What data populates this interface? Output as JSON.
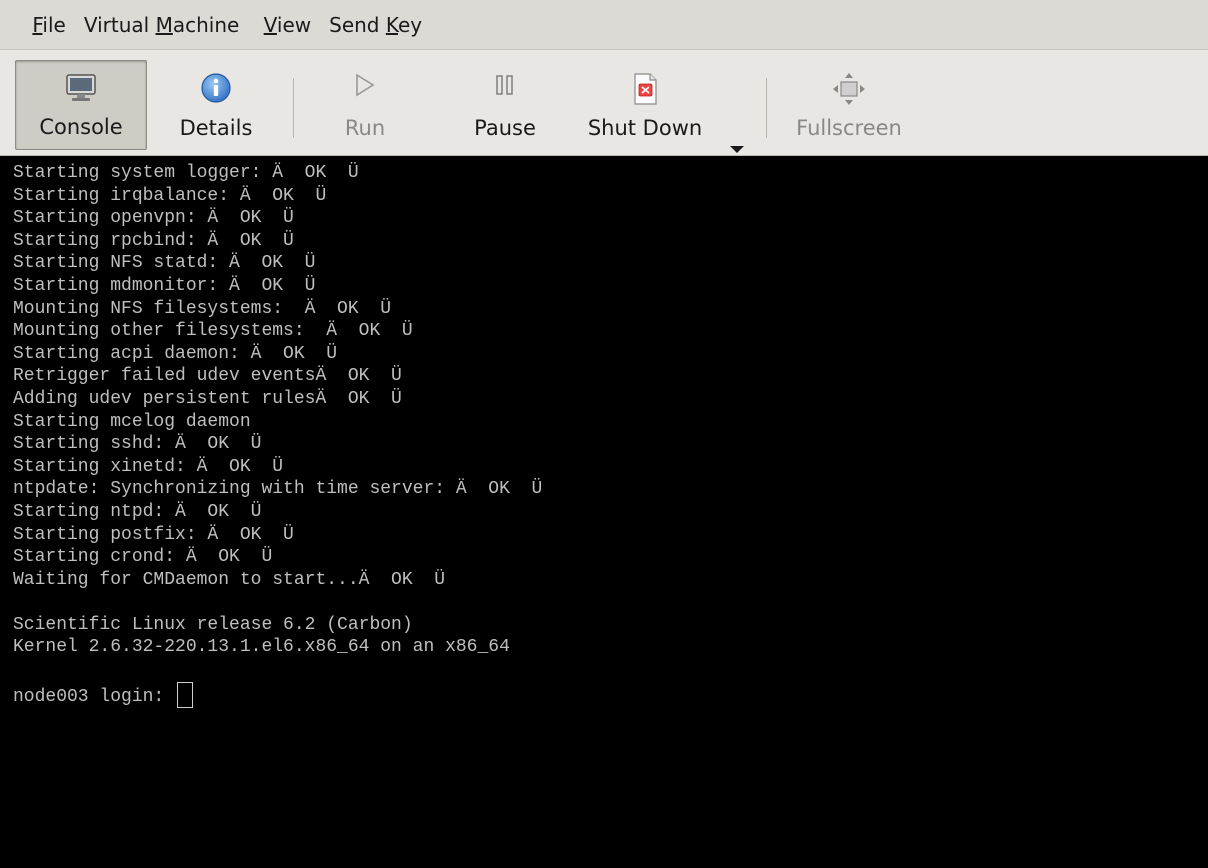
{
  "menubar": {
    "items": [
      {
        "pre": "",
        "key": "F",
        "post": "ile"
      },
      {
        "pre": "Virtual ",
        "key": "M",
        "post": "achine"
      },
      {
        "pre": "",
        "key": "V",
        "post": "iew"
      },
      {
        "pre": "Send ",
        "key": "K",
        "post": "ey"
      }
    ]
  },
  "toolbar": {
    "console_label": "Console",
    "details_label": "Details",
    "run_label": "Run",
    "pause_label": "Pause",
    "shutdown_label": "Shut Down",
    "fullscreen_label": "Fullscreen"
  },
  "console": {
    "lines": [
      "Starting system logger: Ä  OK  Ü",
      "Starting irqbalance: Ä  OK  Ü",
      "Starting openvpn: Ä  OK  Ü",
      "Starting rpcbind: Ä  OK  Ü",
      "Starting NFS statd: Ä  OK  Ü",
      "Starting mdmonitor: Ä  OK  Ü",
      "Mounting NFS filesystems:  Ä  OK  Ü",
      "Mounting other filesystems:  Ä  OK  Ü",
      "Starting acpi daemon: Ä  OK  Ü",
      "Retrigger failed udev eventsÄ  OK  Ü",
      "Adding udev persistent rulesÄ  OK  Ü",
      "Starting mcelog daemon",
      "Starting sshd: Ä  OK  Ü",
      "Starting xinetd: Ä  OK  Ü",
      "ntpdate: Synchronizing with time server: Ä  OK  Ü",
      "Starting ntpd: Ä  OK  Ü",
      "Starting postfix: Ä  OK  Ü",
      "Starting crond: Ä  OK  Ü",
      "Waiting for CMDaemon to start...Ä  OK  Ü",
      "",
      "Scientific Linux release 6.2 (Carbon)",
      "Kernel 2.6.32-220.13.1.el6.x86_64 on an x86_64",
      ""
    ],
    "prompt": "node003 login: "
  },
  "colors": {
    "terminal_bg": "#000000",
    "terminal_fg": "#bfbfbf",
    "chrome_bg": "#dcdad5",
    "info_blue": "#3a7fd0"
  },
  "icons": {
    "console": "monitor-icon",
    "details": "info-icon",
    "run": "play-icon",
    "pause": "pause-icon",
    "shutdown": "power-icon",
    "fullscreen": "fullscreen-icon"
  }
}
